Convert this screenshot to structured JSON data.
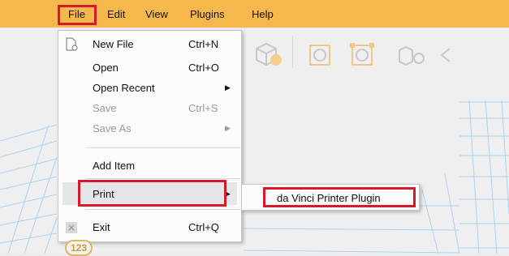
{
  "menubar": {
    "items": [
      "File",
      "Edit",
      "View",
      "Plugins",
      "Help"
    ]
  },
  "file_menu": {
    "new_file": {
      "label": "New File",
      "shortcut": "Ctrl+N",
      "icon": "new-file-icon"
    },
    "open": {
      "label": "Open",
      "shortcut": "Ctrl+O"
    },
    "open_recent": {
      "label": "Open Recent",
      "arrow": "▶"
    },
    "save": {
      "label": "Save",
      "shortcut": "Ctrl+S",
      "disabled": true
    },
    "save_as": {
      "label": "Save As",
      "arrow": "▶",
      "disabled": true
    },
    "add_item": {
      "label": "Add Item"
    },
    "print": {
      "label": "Print",
      "arrow": "▶"
    },
    "exit": {
      "label": "Exit",
      "shortcut": "Ctrl+Q",
      "icon": "exit-icon"
    }
  },
  "print_submenu": {
    "item": "da Vinci Printer Plugin"
  },
  "badge": "123",
  "colors": {
    "menubar": "#f6b84d",
    "highlight": "#d51a2c",
    "grid": "#a9d4ef"
  }
}
